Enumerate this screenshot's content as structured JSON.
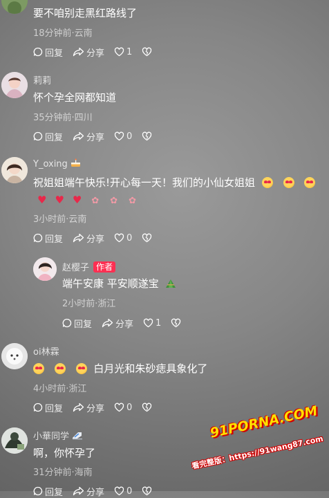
{
  "comments": [
    {
      "text": "要不咱别走黑红路线了",
      "meta": "18分钟前·云南",
      "reply": "回复",
      "share": "分享",
      "likes": "1"
    },
    {
      "name": "莉莉",
      "text": "怀个孕全网都知道",
      "meta": "35分钟前·四川",
      "reply": "回复",
      "share": "分享",
      "likes": "0"
    },
    {
      "name": "Y_oxing",
      "name_emoji": "cake-icon",
      "text": "祝姐姐端午快乐!开心每一天！我们的小仙女姐姐",
      "meta": "3小时前·云南",
      "reply": "回复",
      "share": "分享",
      "likes": "0"
    },
    {
      "name": "赵樱子",
      "badge": "作者",
      "text": "端午安康 平安顺遂宝",
      "text_emoji": "rice-dumpling-icon",
      "meta": "2小时前·浙江",
      "reply": "回复",
      "share": "分享",
      "likes": "1"
    },
    {
      "name": "oi林霖",
      "text": "白月光和朱砂痣具象化了",
      "meta": "4小时前·浙江",
      "reply": "回复",
      "share": "分享",
      "likes": "0"
    },
    {
      "name": "小華同学",
      "text": "啊，你怀孕了",
      "meta": "31分钟前·海南",
      "reply": "回复",
      "share": "分享",
      "likes": "0"
    }
  ],
  "watermark": {
    "brand": "91PORNA.COM",
    "url_line": "看完整版：https://91wang87.com"
  },
  "colors": {
    "author_badge": "#ff2f52",
    "accent_heart": "#e8284a"
  }
}
